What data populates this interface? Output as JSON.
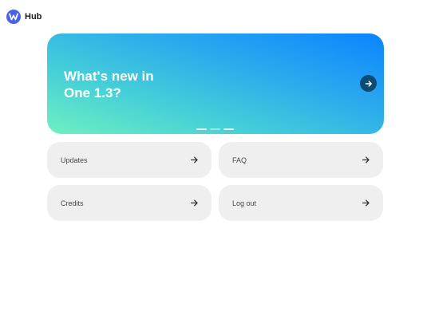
{
  "app": {
    "brand_name": "Hub",
    "logo_icon": "hub-logo-icon",
    "accent_color": "#4a63e6"
  },
  "hero": {
    "title": "What's new in One 1.3?",
    "next_icon": "arrow-right-icon",
    "slides": {
      "total": 3,
      "active_index": 0
    },
    "gradient_colors": [
      "#6ff0c0",
      "#0a84ff"
    ]
  },
  "tiles": [
    {
      "label": "Updates",
      "icon": "arrow-right-icon"
    },
    {
      "label": "FAQ",
      "icon": "arrow-right-icon"
    },
    {
      "label": "Credits",
      "icon": "arrow-right-icon"
    },
    {
      "label": "Log out",
      "icon": "arrow-right-icon"
    }
  ]
}
